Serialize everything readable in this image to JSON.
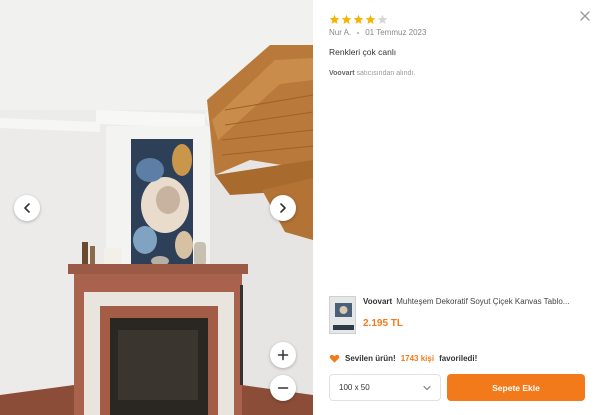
{
  "photo": {
    "alt_icons": {
      "prev": "chevron-left-icon",
      "next": "chevron-right-icon",
      "zoom_in": "plus-icon",
      "zoom_out": "minus-icon"
    }
  },
  "review": {
    "rating": 4,
    "max_rating": 5,
    "author": "Nur A.",
    "date": "01 Temmuz 2023",
    "text": "Renkleri çok canlı",
    "seller_name": "Voovart",
    "seller_suffix": "satıcısından alındı."
  },
  "product": {
    "brand": "Voovart",
    "title": "Muhteşem Dekoratif Soyut Çiçek Kanvas Tablo...",
    "price": "2.195 TL"
  },
  "favorite": {
    "label": "Sevilen ürün!",
    "count": "1743 kişi",
    "suffix": "favoriledi!"
  },
  "size_select": {
    "value": "100 x 50"
  },
  "cart": {
    "label": "Sepete Ekle"
  },
  "colors": {
    "accent": "#f27a1a",
    "star_filled": "#f5b400",
    "star_empty": "#d6d6d6"
  }
}
